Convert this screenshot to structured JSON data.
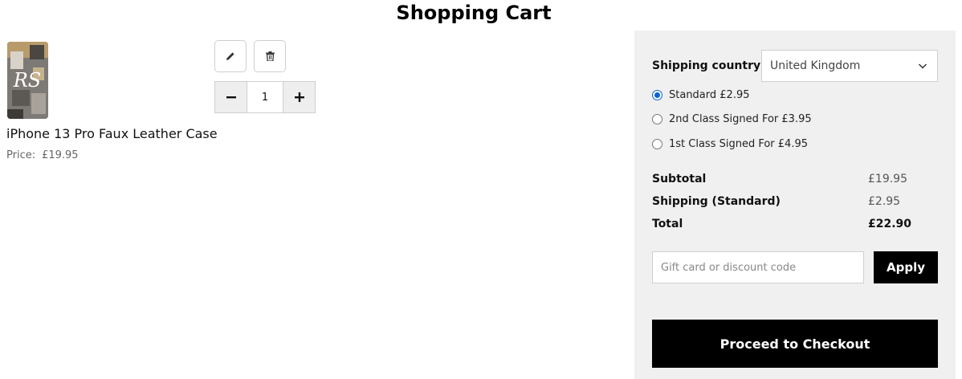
{
  "page": {
    "title": "Shopping Cart"
  },
  "cart": {
    "item": {
      "name": "iPhone 13 Pro Faux Leather Case",
      "price_label": "Price:",
      "price": "£19.95",
      "quantity": "1",
      "thumbnail_text": "RS",
      "icons": {
        "edit": "pencil-icon",
        "delete": "trash-icon",
        "decrease": "minus-icon",
        "increase": "plus-icon"
      }
    }
  },
  "summary": {
    "shipping_country_label": "Shipping country:",
    "shipping_country": "United Kingdom",
    "shipping_options": [
      {
        "label": "Standard £2.95",
        "selected": true
      },
      {
        "label": "2nd Class Signed For £3.95",
        "selected": false
      },
      {
        "label": "1st Class Signed For £4.95",
        "selected": false
      }
    ],
    "subtotal_label": "Subtotal",
    "subtotal": "£19.95",
    "shipping_line_label": "Shipping (Standard)",
    "shipping_cost": "£2.95",
    "total_label": "Total",
    "total": "£22.90",
    "discount_placeholder": "Gift card or discount code",
    "apply_label": "Apply",
    "checkout_label": "Proceed to Checkout"
  },
  "colors": {
    "accent": "#0b63d6",
    "panel": "#f0f0f1",
    "button": "#000000"
  }
}
